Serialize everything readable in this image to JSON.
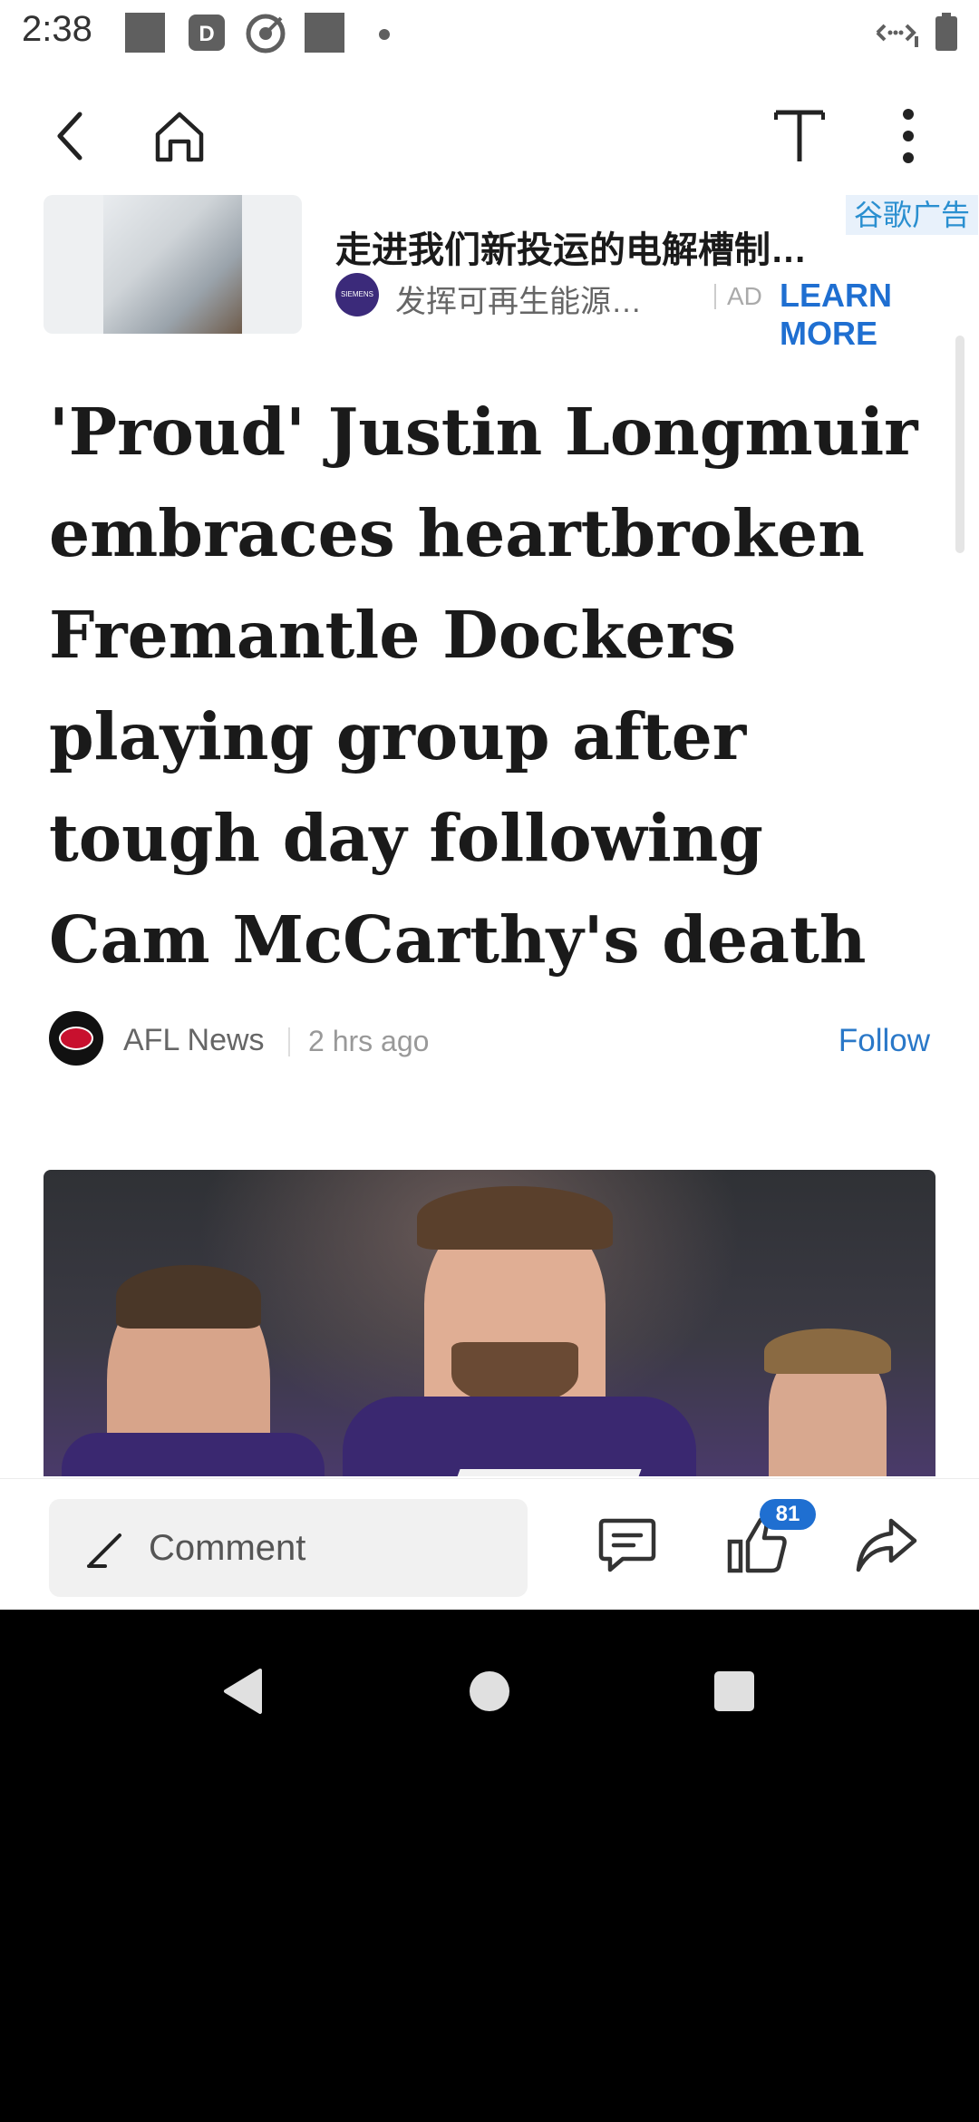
{
  "status_bar": {
    "time": "2:38",
    "icons": [
      "square-icon",
      "d-app-icon",
      "target-icon",
      "square-icon",
      "dot-icon",
      "signal-icon",
      "battery-icon"
    ]
  },
  "toolbar": {
    "back_icon": "chevron-left-icon",
    "home_icon": "home-icon",
    "text_size_icon": "text-size-icon",
    "more_icon": "more-vertical-icon"
  },
  "ad": {
    "title": "走进我们新投运的电解槽制…",
    "badge": "谷歌广告",
    "brand_logo_text": "SIEMENS energy",
    "subtitle": "发挥可再生能源…",
    "tag": "AD",
    "cta": "LEARN MORE"
  },
  "article": {
    "headline": "'Proud' Justin Longmuir embraces heartbroken Fremantle Dockers playing group after tough day following Cam McCarthy's death",
    "source_name": "AFL News",
    "time_ago": "2 hrs ago",
    "follow_label": "Follow"
  },
  "action_bar": {
    "comment_placeholder": "Comment",
    "like_count": "81"
  },
  "nav_bar": {
    "icons": [
      "back-triangle-icon",
      "home-circle-icon",
      "recents-square-icon"
    ]
  },
  "colors": {
    "accent": "#1f6fd1",
    "follow": "#2a78c8",
    "headline": "#1a1a1a",
    "jersey": "#3a2870"
  }
}
